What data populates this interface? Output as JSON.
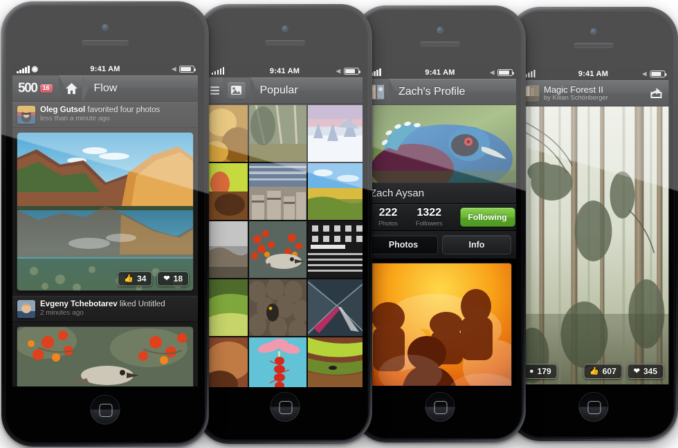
{
  "meta": {
    "status_time": "9:41 AM"
  },
  "phones": [
    {
      "id": "phone-flow",
      "nav": {
        "logo": "500",
        "badge": "16",
        "home_icon": "home-icon",
        "title": "Flow"
      },
      "feed": [
        {
          "actor": "Oleg Gutsol",
          "action": "favorited four photos",
          "time": "less than a minute ago",
          "likes": "34",
          "hearts": "18"
        },
        {
          "actor": "Evgeny Tchebotarev",
          "action": "liked Untitled",
          "time": "2 minutes ago",
          "likes": "",
          "hearts": ""
        }
      ]
    },
    {
      "id": "phone-popular",
      "nav": {
        "menu_icon": "hamburger-menu-icon",
        "photo_icon": "photo-icon",
        "title": "Popular"
      },
      "grid_label": "popular-photo-grid"
    },
    {
      "id": "phone-profile",
      "nav": {
        "avatar": "user-avatar",
        "title": "Zach's Profile"
      },
      "profile": {
        "name": "Zach Aysan",
        "stats": [
          {
            "num": "222",
            "label": "Photos"
          },
          {
            "num": "1322",
            "label": "Followers"
          }
        ],
        "follow_label": "Following",
        "follow_color": "#66b531",
        "tabs": [
          {
            "label": "Photos",
            "active": true
          },
          {
            "label": "Info",
            "active": false
          }
        ]
      }
    },
    {
      "id": "phone-detail",
      "nav": {
        "thumb": "photo-thumbnail",
        "title": "Magic Forest II",
        "subtitle": "by Kilian Schönberger",
        "share_icon": "share-icon"
      },
      "detail": {
        "views": "179",
        "likes": "607",
        "hearts": "345"
      }
    }
  ],
  "icons": {
    "like": "thumbs-up-icon",
    "heart": "heart-icon",
    "view": "eye-icon",
    "wifi": "wifi-icon",
    "bluetooth": "bluetooth-icon",
    "battery": "battery-icon",
    "signal": "signal-bars-icon"
  }
}
